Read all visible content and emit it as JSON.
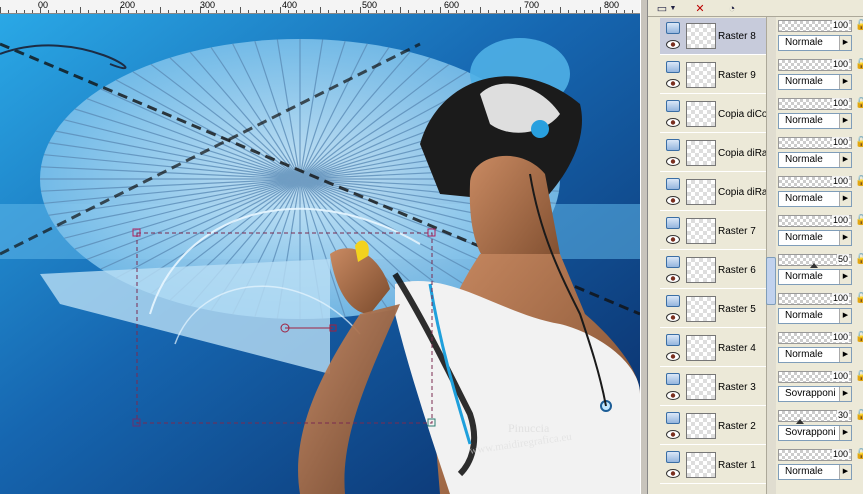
{
  "ruler": {
    "labels": [
      "00",
      "200",
      "300",
      "400",
      "500",
      "600",
      "700",
      "800"
    ]
  },
  "canvas": {
    "watermark_line1": "Pinuccia",
    "watermark_line2": "www.maidiregrafica.eu"
  },
  "palette": {
    "toolbar_icons": [
      "layer-thumbnail-icon",
      "dropdown-arrow-icon",
      "delete-layer-icon",
      "mask-icon"
    ],
    "layers": [
      {
        "name": "Raster 8",
        "opacity": "100",
        "blend": "Normale",
        "selected": true
      },
      {
        "name": "Raster 9",
        "opacity": "100",
        "blend": "Normale",
        "selected": false
      },
      {
        "name": "Copia diCo",
        "opacity": "100",
        "blend": "Normale",
        "selected": false
      },
      {
        "name": "Copia diRa",
        "opacity": "100",
        "blend": "Normale",
        "selected": false
      },
      {
        "name": "Copia diRa",
        "opacity": "100",
        "blend": "Normale",
        "selected": false
      },
      {
        "name": "Raster 7",
        "opacity": "100",
        "blend": "Normale",
        "selected": false
      },
      {
        "name": "Raster 6",
        "opacity": "50",
        "blend": "Normale",
        "selected": false
      },
      {
        "name": "Raster 5",
        "opacity": "100",
        "blend": "Normale",
        "selected": false
      },
      {
        "name": "Raster 4",
        "opacity": "100",
        "blend": "Normale",
        "selected": false
      },
      {
        "name": "Raster 3",
        "opacity": "100",
        "blend": "Sovrapponi",
        "selected": false
      },
      {
        "name": "Raster 2",
        "opacity": "30",
        "blend": "Sovrapponi",
        "selected": false
      },
      {
        "name": "Raster 1",
        "opacity": "100",
        "blend": "Normale",
        "selected": false
      }
    ]
  },
  "colors": {
    "canvas_blue": "#1a6fb4",
    "light_blue": "#a9d4f0",
    "selection": "#c7cbdb"
  }
}
